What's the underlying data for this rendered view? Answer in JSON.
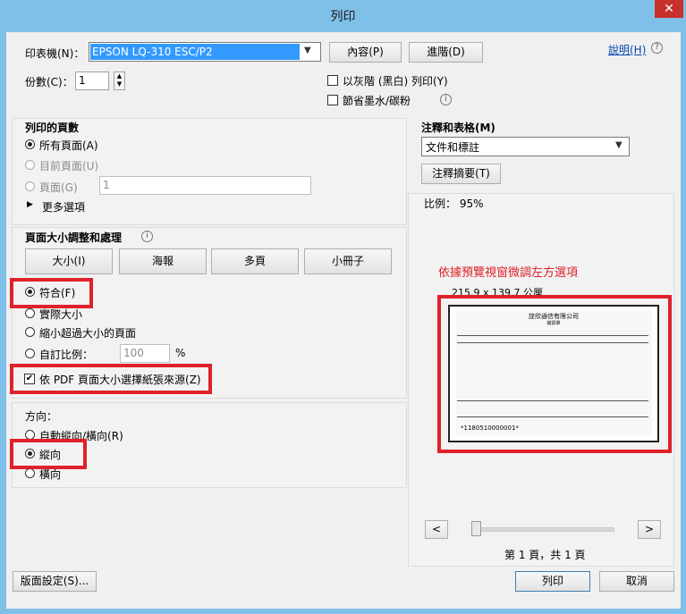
{
  "window": {
    "title": "列印",
    "close": "✕"
  },
  "printer": {
    "label": "印表機(N)：",
    "value": "EPSON LQ-310 ESC/P2",
    "properties_button": "內容(P)",
    "advanced_button": "進階(D)",
    "help_link": "說明(H)"
  },
  "copies": {
    "label": "份數(C)：",
    "value": "1"
  },
  "options": {
    "grayscale": "以灰階 (黑白) 列印(Y)",
    "save_ink": "節省墨水/碳粉"
  },
  "pages_to_print": {
    "title": "列印的頁數",
    "all": "所有頁面(A)",
    "current": "目前頁面(U)",
    "pages": "頁面(G)",
    "pages_value": "1",
    "more": "更多選項"
  },
  "sizing": {
    "title": "頁面大小調整和處理",
    "tab_size": "大小(I)",
    "tab_poster": "海報",
    "tab_multiple": "多頁",
    "tab_booklet": "小冊子",
    "fit": "符合(F)",
    "actual": "實際大小",
    "shrink": "縮小超過大小的頁面",
    "custom": "自訂比例：",
    "custom_value": "100",
    "percent": "%",
    "paper_source": "依 PDF 頁面大小選擇紙張來源(Z)"
  },
  "orientation": {
    "title": "方向：",
    "auto": "自動縱向/橫向(R)",
    "portrait": "縱向",
    "landscape": "橫向"
  },
  "comments": {
    "title": "注釋和表格(M)",
    "value": "文件和標註",
    "summary_button": "注釋摘要(T)"
  },
  "preview": {
    "scale": "比例： 95%",
    "annotation": "依據預覽視窗微調左方選項",
    "size": "215.9 x 139.7 公厘",
    "page_info": "第 1 頁，共 1 頁",
    "prev": "<",
    "next": ">",
    "doc_company": "詮欣通信有限公司",
    "doc_subtitle": "銷貨單",
    "doc_barcode": "*1180510000001*"
  },
  "footer": {
    "page_setup": "版面設定(S)...",
    "print": "列印",
    "cancel": "取消"
  },
  "colors": {
    "accent": "#3c7fb1",
    "annotation": "#e0202a",
    "titlebar": "#7fc0e8"
  }
}
